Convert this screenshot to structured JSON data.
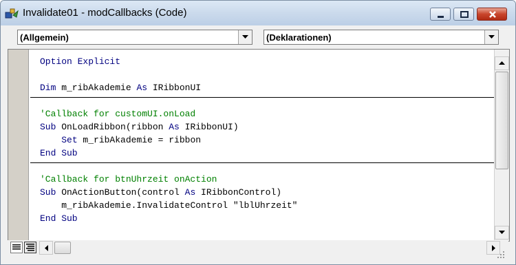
{
  "window": {
    "title": "Invalidate01 - modCallbacks (Code)",
    "caption_buttons": [
      "minimize-button",
      "maximize-button",
      "close-button"
    ]
  },
  "combos": {
    "object": "(Allgemein)",
    "procedure": "(Deklarationen)"
  },
  "code_lines": [
    {
      "indent": "",
      "parts": [
        {
          "t": "Option Explicit",
          "k": "kw"
        }
      ]
    },
    {
      "indent": "",
      "parts": []
    },
    {
      "indent": "",
      "parts": [
        {
          "t": "Dim",
          "k": "kw"
        },
        {
          "t": " m_ribAkademie ",
          "k": ""
        },
        {
          "t": "As",
          "k": "kw"
        },
        {
          "t": " IRibbonUI",
          "k": ""
        }
      ]
    },
    {
      "indent": "",
      "parts": []
    },
    {
      "indent": "",
      "parts": [
        {
          "t": "'Callback for customUI.onLoad",
          "k": "cm"
        }
      ]
    },
    {
      "indent": "",
      "parts": [
        {
          "t": "Sub",
          "k": "kw"
        },
        {
          "t": " OnLoadRibbon(ribbon ",
          "k": ""
        },
        {
          "t": "As",
          "k": "kw"
        },
        {
          "t": " IRibbonUI)",
          "k": ""
        }
      ]
    },
    {
      "indent": "    ",
      "parts": [
        {
          "t": "Set",
          "k": "kw"
        },
        {
          "t": " m_ribAkademie = ribbon",
          "k": ""
        }
      ]
    },
    {
      "indent": "",
      "parts": [
        {
          "t": "End Sub",
          "k": "kw"
        }
      ]
    },
    {
      "indent": "",
      "parts": []
    },
    {
      "indent": "",
      "parts": [
        {
          "t": "'Callback for btnUhrzeit onAction",
          "k": "cm"
        }
      ]
    },
    {
      "indent": "",
      "parts": [
        {
          "t": "Sub",
          "k": "kw"
        },
        {
          "t": " OnActionButton(control ",
          "k": ""
        },
        {
          "t": "As",
          "k": "kw"
        },
        {
          "t": " IRibbonControl)",
          "k": ""
        }
      ]
    },
    {
      "indent": "    ",
      "parts": [
        {
          "t": "m_ribAkademie.InvalidateControl \"lblUhrzeit\"",
          "k": ""
        }
      ]
    },
    {
      "indent": "",
      "parts": [
        {
          "t": "End Sub",
          "k": "kw"
        }
      ]
    }
  ],
  "procedure_separator_after_lines": [
    2,
    7
  ],
  "icons": {
    "app": "vba-module-icon",
    "procedure_view": "procedure-view-icon",
    "full_module_view": "full-module-view-icon"
  },
  "colors": {
    "keyword": "#000080",
    "comment": "#008000",
    "text": "#000000"
  }
}
